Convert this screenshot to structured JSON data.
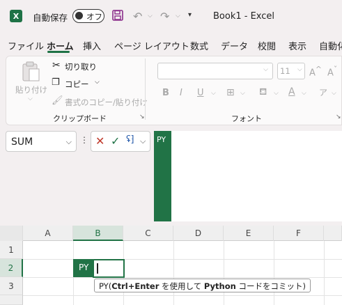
{
  "app": {
    "logo_letter": "X",
    "title": "Book1  -  Excel"
  },
  "qat": {
    "autosave_label": "自動保存",
    "autosave_state": "オフ",
    "customize": "▾"
  },
  "tabs": [
    "ファイル",
    "ホーム",
    "挿入",
    "ページ レイアウト",
    "数式",
    "データ",
    "校閲",
    "表示",
    "自動化"
  ],
  "clipboard": {
    "paste": "貼り付け",
    "cut": "切り取り",
    "copy": "コピー",
    "format_painter": "書式のコピー/貼り付け",
    "group_label": "クリップボード"
  },
  "font": {
    "size": "11",
    "grow": "A^",
    "shrink": "A˅",
    "group_label": "フォント",
    "bold": "B",
    "italic": "I",
    "underline": "U"
  },
  "formula_bar": {
    "name_box": "SUM",
    "py_badge": "PY"
  },
  "grid": {
    "columns": [
      "A",
      "B",
      "C",
      "D",
      "E",
      "F"
    ],
    "rows": [
      "1",
      "2",
      "3"
    ],
    "cell_badge": "PY"
  },
  "tooltip": {
    "prefix": "PY(",
    "keys": "Ctrl+Enter",
    "mid": " を使用して ",
    "lang": "Python",
    "suffix": " コードをコミット)"
  },
  "colors": {
    "accent": "#217346",
    "ribbon_bg": "#fbfafa",
    "window_bg": "#f3eff0"
  }
}
